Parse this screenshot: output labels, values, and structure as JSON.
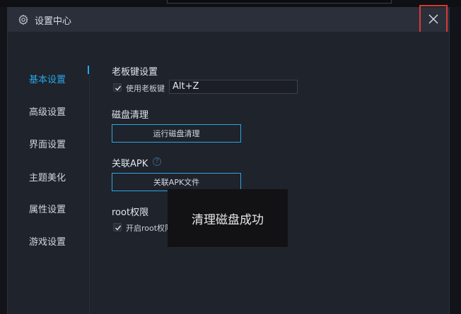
{
  "dialog": {
    "title": "设置中心"
  },
  "sidebar": {
    "items": [
      {
        "label": "基本设置",
        "active": true
      },
      {
        "label": "高级设置"
      },
      {
        "label": "界面设置"
      },
      {
        "label": "主题美化"
      },
      {
        "label": "属性设置"
      },
      {
        "label": "游戏设置"
      }
    ]
  },
  "boss_key": {
    "title": "老板键设置",
    "checkbox_label": "使用老板键",
    "checked": true,
    "hotkey": "Alt+Z"
  },
  "disk_clean": {
    "title": "磁盘清理",
    "button": "运行磁盘清理"
  },
  "apk": {
    "title": "关联APK",
    "help": "?",
    "button": "关联APK文件"
  },
  "root": {
    "title": "root权限",
    "checkbox_label": "开启root权限",
    "checked": true
  },
  "toast": {
    "message": "清理磁盘成功"
  },
  "colors": {
    "accent": "#28a6e7",
    "close_highlight": "#d93a35",
    "bg": "#1f232b"
  }
}
